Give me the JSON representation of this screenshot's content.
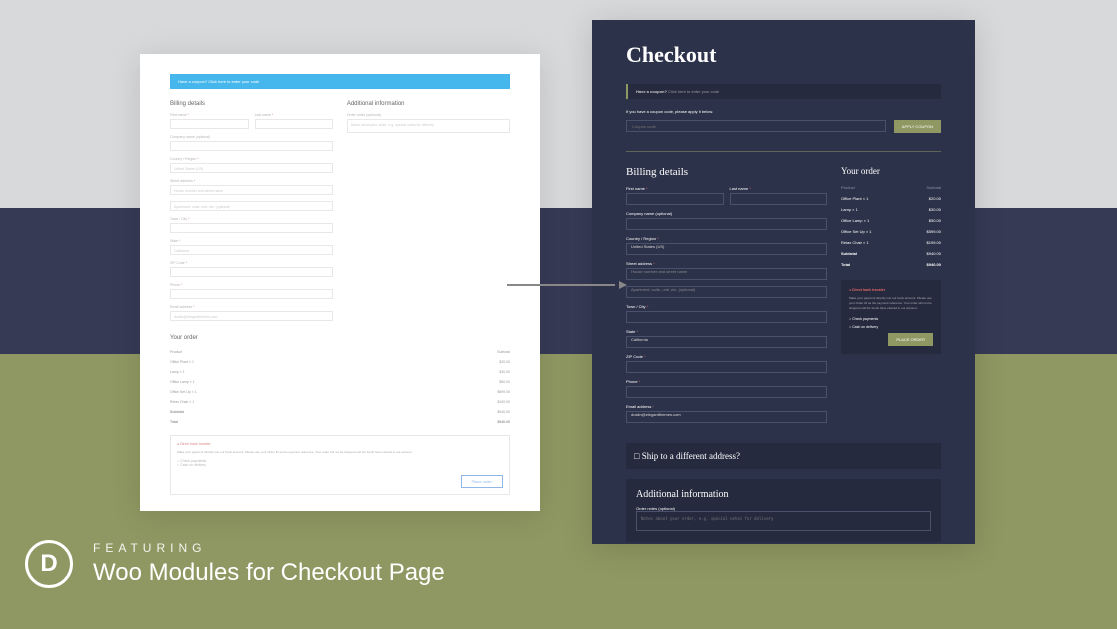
{
  "left": {
    "coupon_msg": "Have a coupon? Click here to enter your code",
    "billing_h": "Billing details",
    "addl_h": "Additional information",
    "fn": "First name",
    "ln": "Last name",
    "notes_lbl": "Order notes (optional)",
    "notes_ph": "Notes about your order, e.g. special notes for delivery",
    "company": "Company name (optional)",
    "country": "Country / Region",
    "country_v": "United States (US)",
    "street": "Street address",
    "street_ph": "House number and street name",
    "apt_ph": "Apartment, suite, unit, etc. (optional)",
    "town": "Town / City",
    "state": "State",
    "state_v": "California",
    "zip": "ZIP Code",
    "phone": "Phone",
    "email": "Email address",
    "email_v": "dustin@elegantthemes.com",
    "order_h": "Your order",
    "prod_h": "Product",
    "sub_h": "Subtotal",
    "rows": [
      {
        "p": "Office Plant × 1",
        "s": "$20.00"
      },
      {
        "p": "Lamp × 1",
        "s": "$30.00"
      },
      {
        "p": "Office Lamp × 1",
        "s": "$50.00"
      },
      {
        "p": "Office Set Up × 1",
        "s": "$599.00"
      },
      {
        "p": "Relax Chair × 1",
        "s": "$199.00"
      }
    ],
    "subtotal_l": "Subtotal",
    "subtotal_v": "$940.00",
    "total_l": "Total",
    "total_v": "$940.00",
    "pay1": "Direct bank transfer",
    "pay1_desc": "Make your payment directly into our bank account. Please use your Order ID as the payment reference. Your order will not be shipped until the funds have cleared in our account.",
    "pay2": "Check payments",
    "pay3": "Cash on delivery",
    "place": "Place order"
  },
  "right": {
    "title": "Checkout",
    "coupon_msg": "Have a coupon?",
    "coupon_link": "Click here to enter your code",
    "coupon_open_msg": "If you have a coupon code, please apply it below.",
    "coupon_ph": "Coupon code",
    "apply": "APPLY COUPON",
    "billing_h": "Billing details",
    "fn": "First name",
    "ln": "Last name",
    "company": "Company name (optional)",
    "country": "Country / Region",
    "country_v": "United States (US)",
    "street": "Street address",
    "street_ph": "House number and street name",
    "apt_ph": "Apartment, suite, unit, etc. (optional)",
    "town": "Town / City",
    "state": "State",
    "state_v": "California",
    "zip": "ZIP Code",
    "phone": "Phone",
    "email": "Email address",
    "email_v": "dustin@elegantthemes.com",
    "order_h": "Your order",
    "prod_h": "Product",
    "sub_h": "Subtotal",
    "rows": [
      {
        "p": "Office Plant × 1",
        "s": "$20.00"
      },
      {
        "p": "Lamp × 1",
        "s": "$30.00"
      },
      {
        "p": "Office Lamp × 1",
        "s": "$50.00"
      },
      {
        "p": "Office Set Up × 1",
        "s": "$599.00"
      },
      {
        "p": "Relax Chair × 1",
        "s": "$199.00"
      }
    ],
    "subtotal_l": "Subtotal",
    "subtotal_v": "$940.00",
    "total_l": "Total",
    "total_v": "$940.00",
    "pay1": "Direct bank transfer",
    "pay1_desc": "Make your payment directly into our bank account. Please use your Order ID as the payment reference. Your order will not be shipped until the funds have cleared in our account.",
    "pay2": "Check payments",
    "pay3": "Cash on delivery",
    "place": "PLACE ORDER",
    "ship": "Ship to a different address?",
    "addl_h": "Additional information",
    "notes_lbl": "Order notes (optional)",
    "notes_ph": "Notes about your order, e.g. special notes for delivery"
  },
  "footer": {
    "logo": "D",
    "small": "FEATURING",
    "large": "Woo Modules for Checkout Page"
  }
}
